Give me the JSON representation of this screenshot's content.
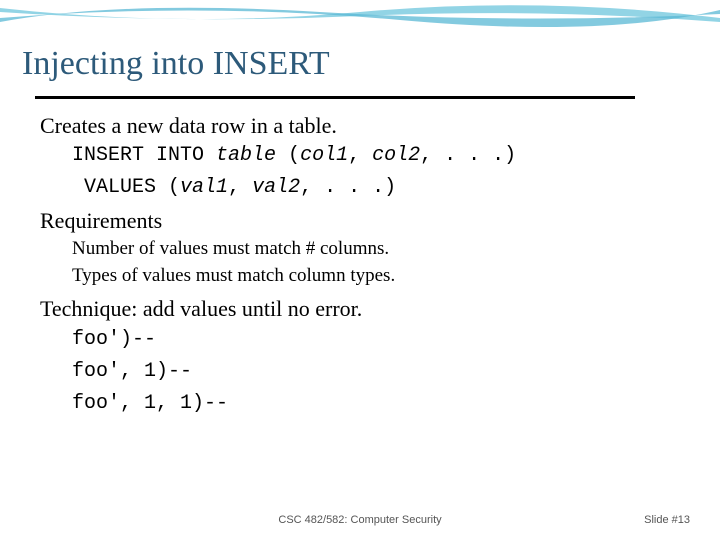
{
  "title": "Injecting into INSERT",
  "line1": "Creates a new data row in a table.",
  "code1_a": "INSERT INTO ",
  "code1_b": "table",
  "code1_c": " (",
  "code1_d": "col1",
  "code1_e": ", ",
  "code1_f": "col2",
  "code1_g": ", . . .)",
  "code2_a": " VALUES (",
  "code2_b": "val1",
  "code2_c": ", ",
  "code2_d": "val2",
  "code2_e": ", . . .)",
  "req_heading": "Requirements",
  "req1": "Number of values must match # columns.",
  "req2": "Types of values must match column types.",
  "technique": "Technique: add values until no error.",
  "ex1": "foo')--",
  "ex2": "foo', 1)--",
  "ex3": "foo', 1, 1)--",
  "footer_center": "CSC 482/582: Computer Security",
  "footer_right": "Slide #13"
}
